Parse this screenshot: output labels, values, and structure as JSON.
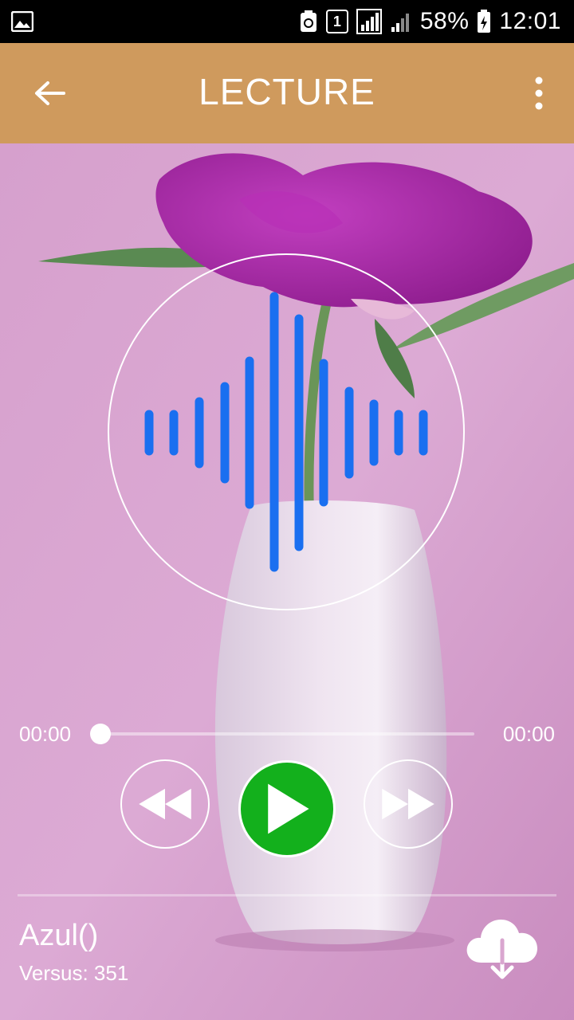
{
  "status_bar": {
    "battery": "58%",
    "time": "12:01",
    "sim_slot": "1"
  },
  "app_bar": {
    "title": "LECTURE",
    "color": "#cf9a5d"
  },
  "player": {
    "current_time": "00:00",
    "total_time": "00:00",
    "progress": 0,
    "play_color": "#13b01c",
    "visualizer_color": "#1a6ff0"
  },
  "track": {
    "title": "Azul()",
    "subtitle": "Versus: 351"
  },
  "icons": {
    "back": "arrow-left-icon",
    "menu": "more-vert-icon",
    "rewind": "rewind-icon",
    "play": "play-icon",
    "forward": "fast-forward-icon",
    "download": "cloud-download-icon"
  }
}
